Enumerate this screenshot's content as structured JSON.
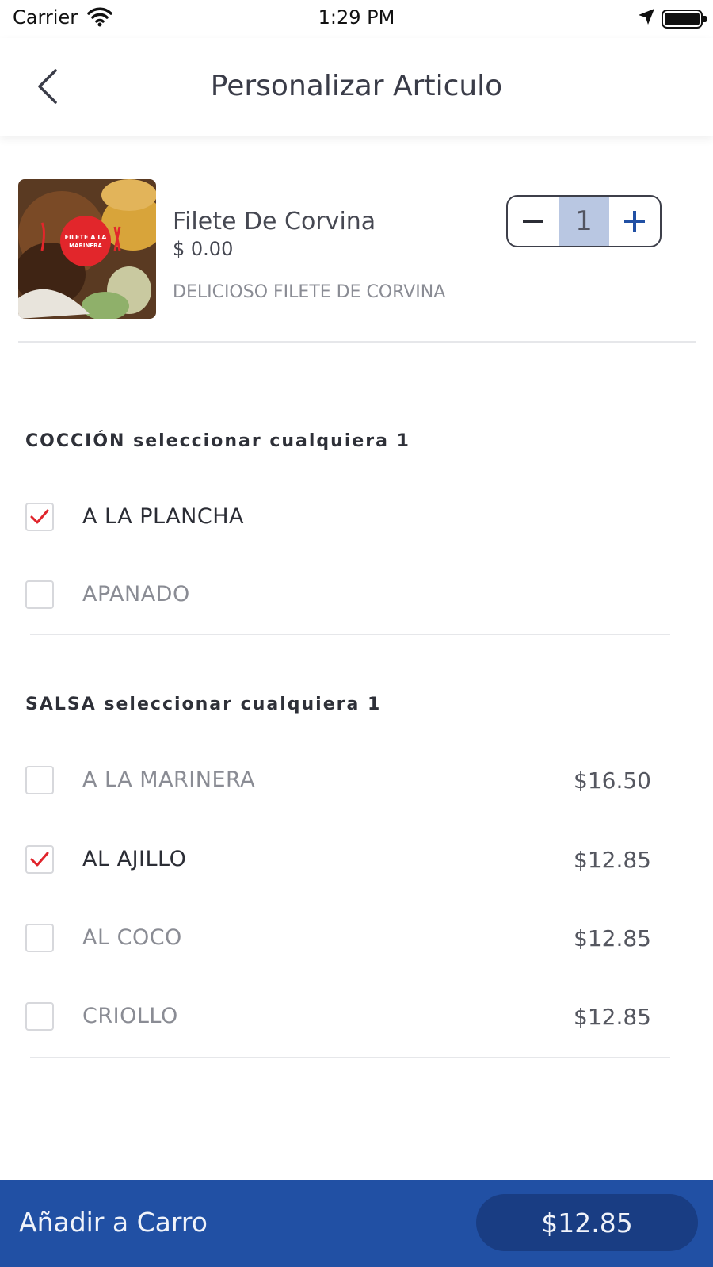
{
  "status_bar": {
    "carrier": "Carrier",
    "time": "1:29 PM"
  },
  "header": {
    "title": "Personalizar Articulo"
  },
  "item": {
    "name": "Filete De Corvina",
    "price": "$ 0.00",
    "description": "DELICIOSO FILETE DE CORVINA",
    "quantity": "1",
    "image_caption": "FILETE A LA MARINERA"
  },
  "sections": [
    {
      "title": "COCCIÓN seleccionar cualquiera 1",
      "options": [
        {
          "label": "A LA PLANCHA",
          "price": "",
          "checked": true
        },
        {
          "label": "APANADO",
          "price": "",
          "checked": false
        }
      ]
    },
    {
      "title": "SALSA seleccionar cualquiera 1",
      "options": [
        {
          "label": "A LA MARINERA",
          "price": "$16.50",
          "checked": false
        },
        {
          "label": "AL AJILLO",
          "price": "$12.85",
          "checked": true
        },
        {
          "label": "AL COCO",
          "price": "$12.85",
          "checked": false
        },
        {
          "label": "CRIOLLO",
          "price": "$12.85",
          "checked": false
        }
      ]
    }
  ],
  "bottom_bar": {
    "add_label": "Añadir a Carro",
    "total": "$12.85"
  },
  "colors": {
    "accent_blue": "#2150a4",
    "pill_blue": "#193d83",
    "check_red": "#e0242b",
    "stepper_qty_bg": "#b9c7e2"
  },
  "icons": {
    "wifi": "wifi-icon",
    "location": "location-arrow-icon",
    "battery": "battery-icon",
    "back": "chevron-left-icon",
    "minus": "minus-icon",
    "plus": "plus-icon",
    "check": "checkmark-icon"
  }
}
